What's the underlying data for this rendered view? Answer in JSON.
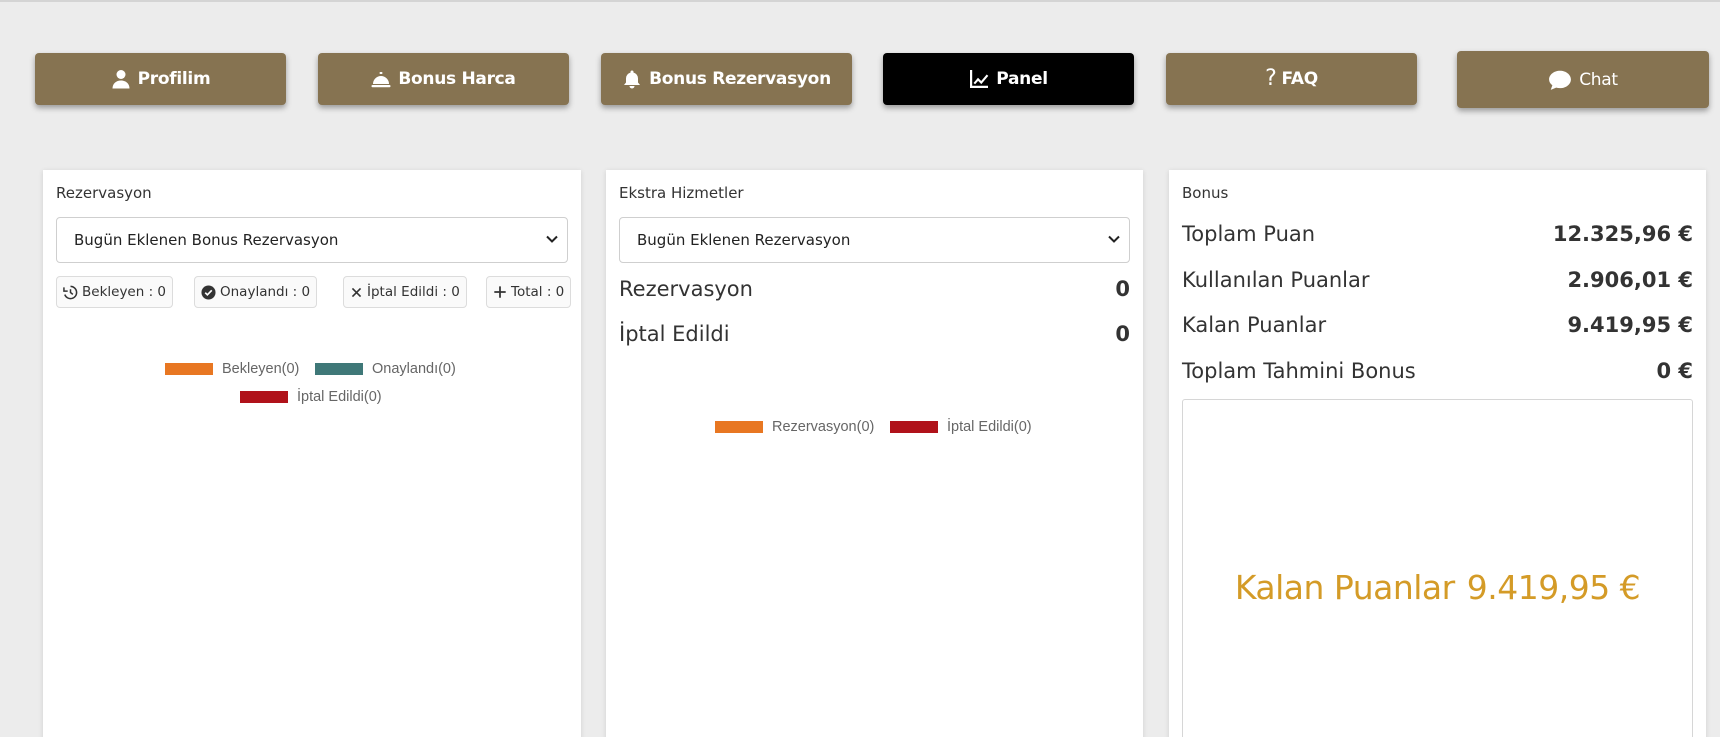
{
  "nav": {
    "profilim": "Profilim",
    "bonus_harca": "Bonus Harca",
    "bonus_rezervasyon": "Bonus Rezervasyon",
    "panel": "Panel",
    "faq": "FAQ",
    "chat": "Chat"
  },
  "colors": {
    "nav_bg": "#867351",
    "nav_active_bg": "#000000",
    "pending": "#e87722",
    "approved": "#3f7878",
    "cancelled": "#b0121a",
    "highlight": "#d49b27"
  },
  "reservation_card": {
    "title": "Rezervasyon",
    "select_value": "Bugün Eklenen Bonus Rezervasyon",
    "chips": {
      "pending": "Bekleyen : 0",
      "approved": "Onaylandı : 0",
      "cancelled": "İptal Edildi : 0",
      "total": "Total : 0"
    },
    "legend": {
      "pending": "Bekleyen(0)",
      "approved": "Onaylandı(0)",
      "cancelled": "İptal Edildi(0)"
    }
  },
  "extra_card": {
    "title": "Ekstra Hizmetler",
    "select_value": "Bugün Eklenen Rezervasyon",
    "rows": [
      {
        "label": "Rezervasyon",
        "value": "0"
      },
      {
        "label": "İptal Edildi",
        "value": "0"
      }
    ],
    "legend": {
      "reservation": "Rezervasyon(0)",
      "cancelled": "İptal Edildi(0)"
    }
  },
  "bonus_card": {
    "title": "Bonus",
    "rows": [
      {
        "label": "Toplam Puan",
        "value": "12.325,96 €"
      },
      {
        "label": "Kullanılan Puanlar",
        "value": "2.906,01 €"
      },
      {
        "label": "Kalan Puanlar",
        "value": "9.419,95 €"
      },
      {
        "label": "Toplam Tahmini Bonus",
        "value": "0 €"
      }
    ],
    "highlight_label": "Kalan Puanlar",
    "highlight_value": "9.419,95 €"
  }
}
